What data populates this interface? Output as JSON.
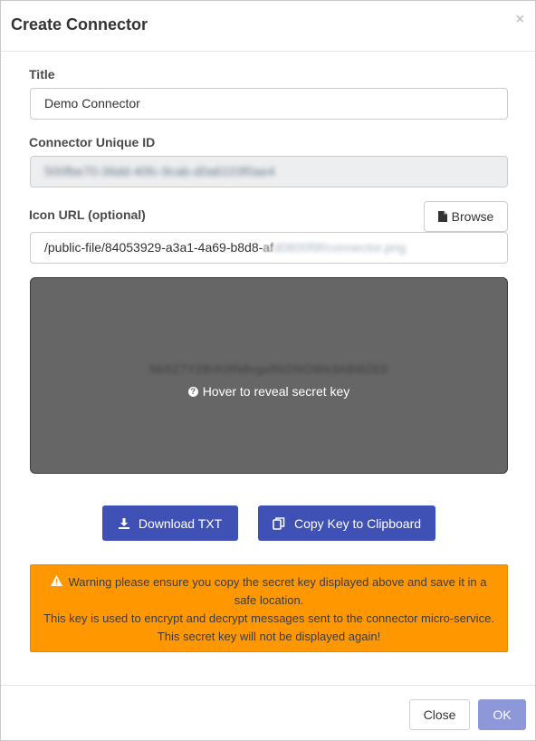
{
  "dialog": {
    "title": "Create Connector",
    "close_glyph": "×"
  },
  "form": {
    "title_label": "Title",
    "title_value": "Demo Connector",
    "unique_id_label": "Connector Unique ID",
    "unique_id_value": "500fbe70-36dd-40fc-9cab-d0a6103f0ae4",
    "icon_url_label": "Icon URL (optional)",
    "browse_label": "Browse",
    "icon_url_prefix": "/public-file/84053929-a3a1-4a69-b8d8-",
    "icon_url_fading": "af",
    "icon_url_hidden": "d0800f9f/connector.png"
  },
  "secret": {
    "key_value": "Nb5Z7Y2BrK0fN8vgeRkDNOWe3ABl8ZE0",
    "hover_hint": "Hover to reveal secret key"
  },
  "actions": {
    "download_label": "Download TXT",
    "copy_label": "Copy Key to Clipboard"
  },
  "warning": {
    "line1": "Warning please ensure you copy the secret key displayed above and save it in a",
    "line2": "safe location.",
    "line3": "This key is used to encrypt and decrypt messages sent to the connector micro-service.",
    "line4": "This secret key will not be displayed again!"
  },
  "footer": {
    "close_label": "Close",
    "ok_label": "OK"
  },
  "colors": {
    "primary": "#3f51b5",
    "ok_disabled": "#8e97d8",
    "warning": "#ff9800",
    "secret_box": "#666666"
  }
}
